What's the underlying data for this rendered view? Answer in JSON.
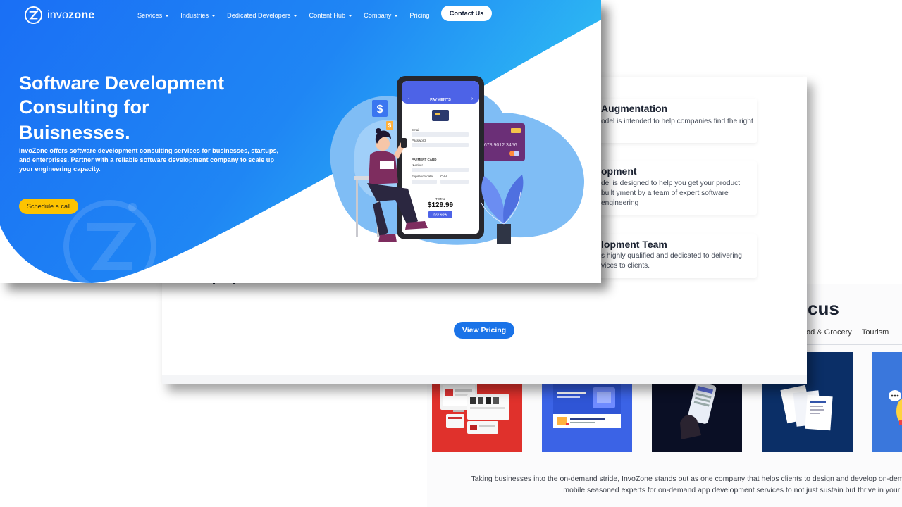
{
  "brand": {
    "name_light": "invo",
    "name_bold": "zone"
  },
  "nav": {
    "items": [
      {
        "label": "Services",
        "dropdown": true
      },
      {
        "label": "Industries",
        "dropdown": true
      },
      {
        "label": "Dedicated Developers",
        "dropdown": true
      },
      {
        "label": "Content Hub",
        "dropdown": true
      },
      {
        "label": "Company",
        "dropdown": true
      },
      {
        "label": "Pricing",
        "dropdown": false
      }
    ],
    "contact_label": "Contact Us"
  },
  "hero": {
    "title_line1": "Software Development",
    "title_line2": "Consulting for",
    "title_line3": "Buisnesses.",
    "description": "InvoZone offers software development consulting services for businesses, startups, and enterprises. Partner with a reliable software development company to scale up your engineering capacity.",
    "cta_label": "Schedule a call"
  },
  "phone": {
    "header": "PAYMENTS",
    "email_label": "Email",
    "password_label": "Password",
    "card_section": "PAYMENT CARD",
    "number_label": "Number",
    "expiry_label": "Expiration date",
    "cvv_label": "CVV",
    "total_label": "TOTAL",
    "total_value": "$129.99",
    "pay_label": "PAY NOW",
    "card_number_fragment": "5678 9012 3456"
  },
  "services": {
    "items": [
      {
        "title": "Augmentation",
        "description": "odel is intended to help companies find the right"
      },
      {
        "title": "opment",
        "description": "del is designed to help you get your product built yment by a team of expert software engineering"
      },
      {
        "title": "lopment Team",
        "description": "s highly qualified and dedicated to delivering vices to clients."
      }
    ],
    "view_pricing_label": "View Pricing"
  },
  "portfolio": {
    "heading": "cus",
    "tabs": [
      "od & Grocery",
      "Tourism"
    ],
    "paragraph": "Taking businesses into the on-demand stride, InvoZone stands out as one company that helps clients to design and develop on-demand mobile seasoned experts for on-demand app development services to not just sustain but thrive in your indu"
  },
  "colors": {
    "hero_gradient_start": "#1a6ff5",
    "hero_gradient_end": "#2fc0f3",
    "cta_yellow": "#fdc300",
    "accent_blue": "#1a73e8"
  }
}
